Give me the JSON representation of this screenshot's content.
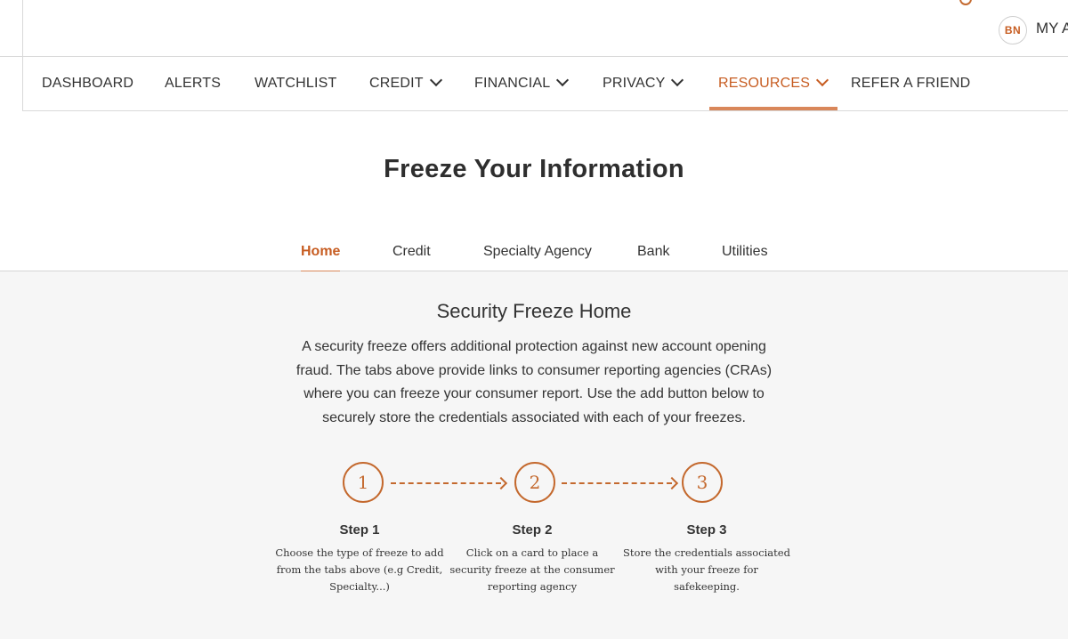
{
  "header": {
    "avatar_initials": "BN",
    "account_label": "MY A",
    "search_icon": "search-icon"
  },
  "nav": {
    "items": [
      {
        "label": "DASHBOARD",
        "has_dropdown": false
      },
      {
        "label": "ALERTS",
        "has_dropdown": false
      },
      {
        "label": "WATCHLIST",
        "has_dropdown": false
      },
      {
        "label": "CREDIT",
        "has_dropdown": true
      },
      {
        "label": "FINANCIAL",
        "has_dropdown": true
      },
      {
        "label": "PRIVACY",
        "has_dropdown": true
      },
      {
        "label": "RESOURCES",
        "has_dropdown": true,
        "active": true
      },
      {
        "label": "REFER A FRIEND",
        "has_dropdown": false
      }
    ]
  },
  "page": {
    "title": "Freeze Your Information"
  },
  "subtabs": [
    {
      "label": "Home",
      "active": true
    },
    {
      "label": "Credit"
    },
    {
      "label": "Specialty Agency"
    },
    {
      "label": "Bank"
    },
    {
      "label": "Utilities"
    }
  ],
  "section": {
    "title": "Security Freeze Home",
    "description": "A security freeze offers additional protection against new account opening fraud. The tabs above provide links to consumer reporting agencies (CRAs) where you can freeze your consumer report. Use the add button below to securely store the credentials associated with each of your freezes."
  },
  "steps": [
    {
      "number": "1",
      "title": "Step 1",
      "text": "Choose the type of freeze to add from the tabs above (e.g Credit, Specialty...)"
    },
    {
      "number": "2",
      "title": "Step 2",
      "text": "Click on a card to place a security freeze at the consumer reporting agency"
    },
    {
      "number": "3",
      "title": "Step 3",
      "text": "Store the credentials associated with your freeze for safekeeping."
    }
  ],
  "colors": {
    "accent": "#c75d22",
    "content_bg": "#f6f6f6"
  }
}
